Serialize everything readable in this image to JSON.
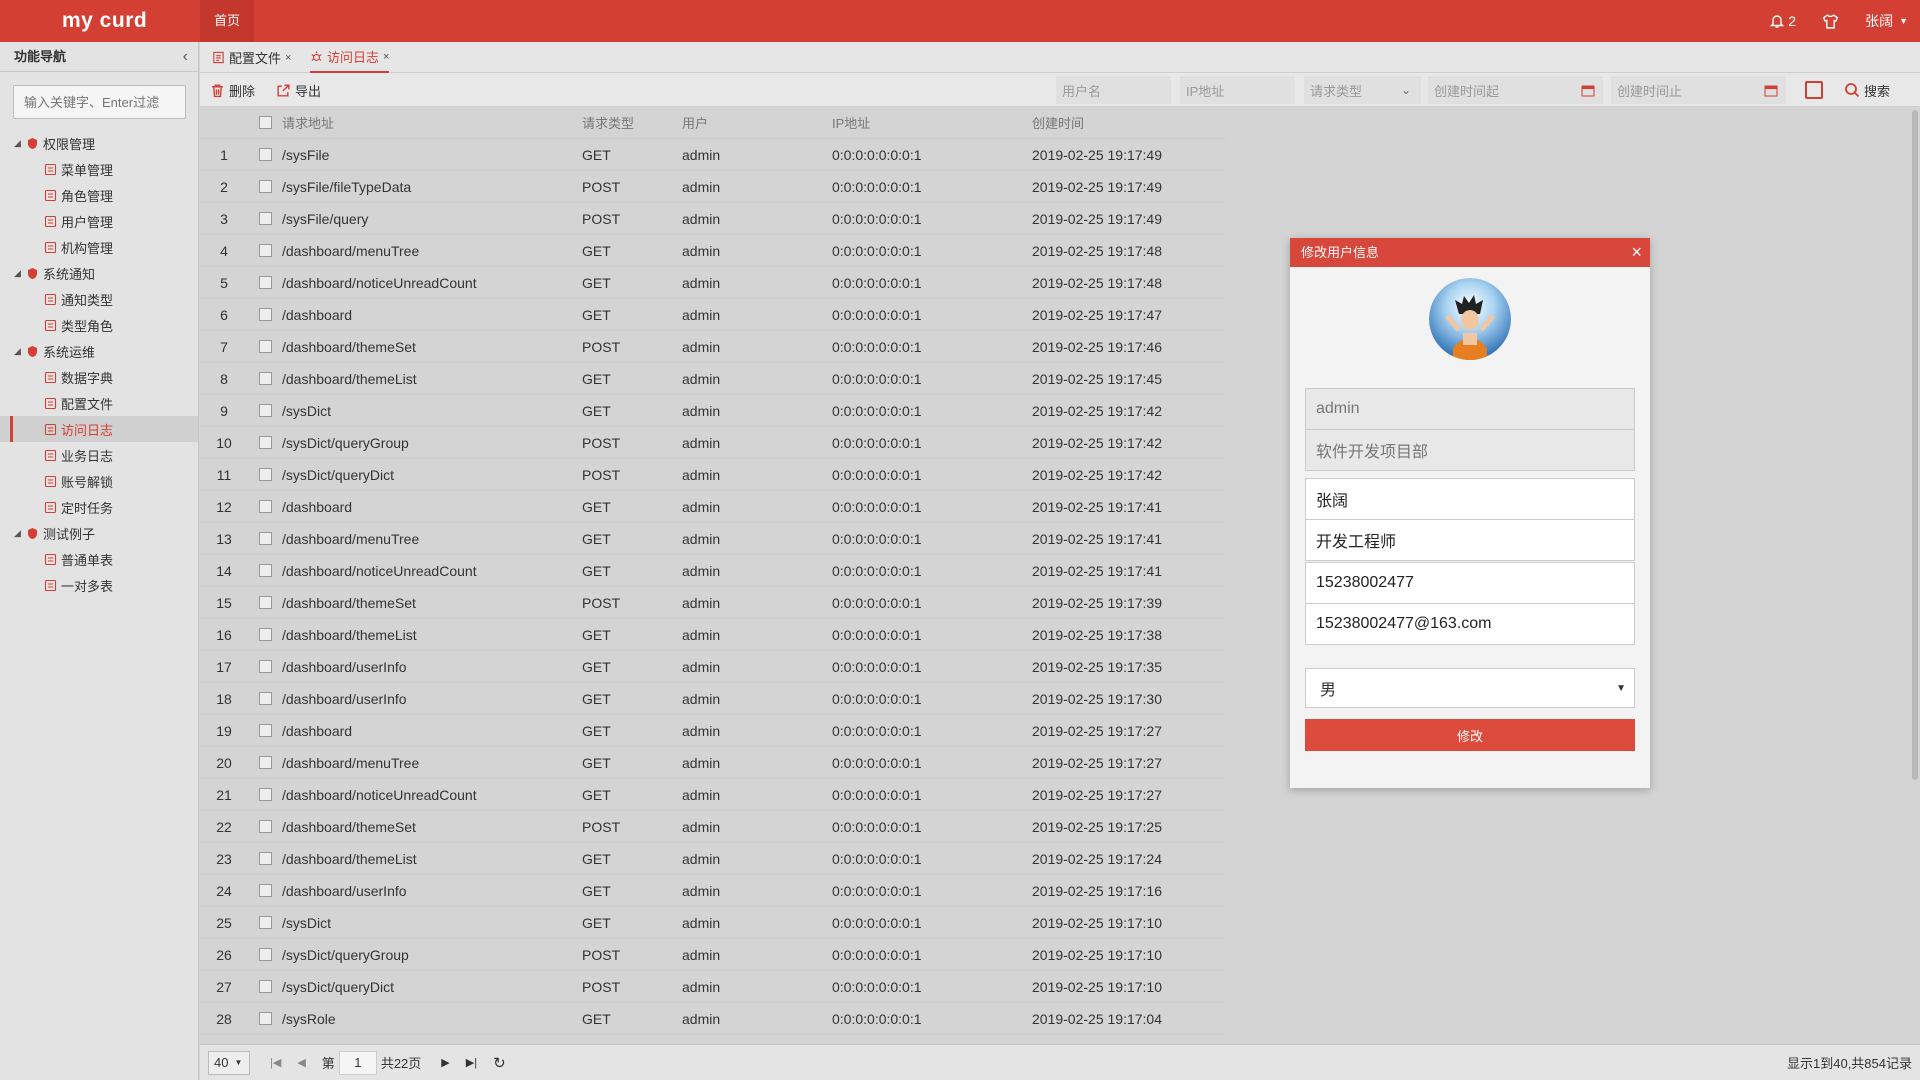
{
  "app": {
    "logo": "my curd",
    "home_tab": "首页",
    "notif_count": "2",
    "user_name": "张阔"
  },
  "sidebar": {
    "title": "功能导航",
    "search_placeholder": "输入关键字、Enter过滤",
    "tree": [
      {
        "type": "group",
        "label": "权限管理",
        "icon": "shield-icon"
      },
      {
        "type": "leaf",
        "label": "菜单管理",
        "icon": "menu-icon"
      },
      {
        "type": "leaf",
        "label": "角色管理",
        "icon": "shirt-icon"
      },
      {
        "type": "leaf",
        "label": "用户管理",
        "icon": "user-icon"
      },
      {
        "type": "leaf",
        "label": "机构管理",
        "icon": "building-icon"
      },
      {
        "type": "group",
        "label": "系统通知",
        "icon": "bell-icon"
      },
      {
        "type": "leaf",
        "label": "通知类型",
        "icon": "grid-icon"
      },
      {
        "type": "leaf",
        "label": "类型角色",
        "icon": "share-icon"
      },
      {
        "type": "group",
        "label": "系统运维",
        "icon": "gears-icon"
      },
      {
        "type": "leaf",
        "label": "数据字典",
        "icon": "book-icon"
      },
      {
        "type": "leaf",
        "label": "配置文件",
        "icon": "file-icon"
      },
      {
        "type": "leaf",
        "label": "访问日志",
        "icon": "bug-icon",
        "active": true
      },
      {
        "type": "leaf",
        "label": "业务日志",
        "icon": "log-icon"
      },
      {
        "type": "leaf",
        "label": "账号解锁",
        "icon": "lock-icon"
      },
      {
        "type": "leaf",
        "label": "定时任务",
        "icon": "clock-icon"
      },
      {
        "type": "group",
        "label": "测试例子",
        "icon": "table-icon"
      },
      {
        "type": "leaf",
        "label": "普通单表",
        "icon": "table-icon"
      },
      {
        "type": "leaf",
        "label": "一对多表",
        "icon": "table-icon"
      }
    ]
  },
  "tabs": [
    {
      "label": "配置文件",
      "close": "×"
    },
    {
      "label": "访问日志",
      "close": "×",
      "active": true
    }
  ],
  "toolbar": {
    "delete_label": "删除",
    "export_label": "导出",
    "username_ph": "用户名",
    "ip_ph": "IP地址",
    "reqtype_ph": "请求类型",
    "time_from_ph": "创建时间起",
    "time_to_ph": "创建时间止",
    "search_label": "搜索"
  },
  "table": {
    "headers": {
      "url": "请求地址",
      "type": "请求类型",
      "user": "用户",
      "ip": "IP地址",
      "time": "创建时间"
    },
    "rows": [
      [
        "1",
        "/sysFile",
        "GET",
        "admin",
        "0:0:0:0:0:0:0:1",
        "2019-02-25 19:17:49"
      ],
      [
        "2",
        "/sysFile/fileTypeData",
        "POST",
        "admin",
        "0:0:0:0:0:0:0:1",
        "2019-02-25 19:17:49"
      ],
      [
        "3",
        "/sysFile/query",
        "POST",
        "admin",
        "0:0:0:0:0:0:0:1",
        "2019-02-25 19:17:49"
      ],
      [
        "4",
        "/dashboard/menuTree",
        "GET",
        "admin",
        "0:0:0:0:0:0:0:1",
        "2019-02-25 19:17:48"
      ],
      [
        "5",
        "/dashboard/noticeUnreadCount",
        "GET",
        "admin",
        "0:0:0:0:0:0:0:1",
        "2019-02-25 19:17:48"
      ],
      [
        "6",
        "/dashboard",
        "GET",
        "admin",
        "0:0:0:0:0:0:0:1",
        "2019-02-25 19:17:47"
      ],
      [
        "7",
        "/dashboard/themeSet",
        "POST",
        "admin",
        "0:0:0:0:0:0:0:1",
        "2019-02-25 19:17:46"
      ],
      [
        "8",
        "/dashboard/themeList",
        "GET",
        "admin",
        "0:0:0:0:0:0:0:1",
        "2019-02-25 19:17:45"
      ],
      [
        "9",
        "/sysDict",
        "GET",
        "admin",
        "0:0:0:0:0:0:0:1",
        "2019-02-25 19:17:42"
      ],
      [
        "10",
        "/sysDict/queryGroup",
        "POST",
        "admin",
        "0:0:0:0:0:0:0:1",
        "2019-02-25 19:17:42"
      ],
      [
        "11",
        "/sysDict/queryDict",
        "POST",
        "admin",
        "0:0:0:0:0:0:0:1",
        "2019-02-25 19:17:42"
      ],
      [
        "12",
        "/dashboard",
        "GET",
        "admin",
        "0:0:0:0:0:0:0:1",
        "2019-02-25 19:17:41"
      ],
      [
        "13",
        "/dashboard/menuTree",
        "GET",
        "admin",
        "0:0:0:0:0:0:0:1",
        "2019-02-25 19:17:41"
      ],
      [
        "14",
        "/dashboard/noticeUnreadCount",
        "GET",
        "admin",
        "0:0:0:0:0:0:0:1",
        "2019-02-25 19:17:41"
      ],
      [
        "15",
        "/dashboard/themeSet",
        "POST",
        "admin",
        "0:0:0:0:0:0:0:1",
        "2019-02-25 19:17:39"
      ],
      [
        "16",
        "/dashboard/themeList",
        "GET",
        "admin",
        "0:0:0:0:0:0:0:1",
        "2019-02-25 19:17:38"
      ],
      [
        "17",
        "/dashboard/userInfo",
        "GET",
        "admin",
        "0:0:0:0:0:0:0:1",
        "2019-02-25 19:17:35"
      ],
      [
        "18",
        "/dashboard/userInfo",
        "GET",
        "admin",
        "0:0:0:0:0:0:0:1",
        "2019-02-25 19:17:30"
      ],
      [
        "19",
        "/dashboard",
        "GET",
        "admin",
        "0:0:0:0:0:0:0:1",
        "2019-02-25 19:17:27"
      ],
      [
        "20",
        "/dashboard/menuTree",
        "GET",
        "admin",
        "0:0:0:0:0:0:0:1",
        "2019-02-25 19:17:27"
      ],
      [
        "21",
        "/dashboard/noticeUnreadCount",
        "GET",
        "admin",
        "0:0:0:0:0:0:0:1",
        "2019-02-25 19:17:27"
      ],
      [
        "22",
        "/dashboard/themeSet",
        "POST",
        "admin",
        "0:0:0:0:0:0:0:1",
        "2019-02-25 19:17:25"
      ],
      [
        "23",
        "/dashboard/themeList",
        "GET",
        "admin",
        "0:0:0:0:0:0:0:1",
        "2019-02-25 19:17:24"
      ],
      [
        "24",
        "/dashboard/userInfo",
        "GET",
        "admin",
        "0:0:0:0:0:0:0:1",
        "2019-02-25 19:17:16"
      ],
      [
        "25",
        "/sysDict",
        "GET",
        "admin",
        "0:0:0:0:0:0:0:1",
        "2019-02-25 19:17:10"
      ],
      [
        "26",
        "/sysDict/queryGroup",
        "POST",
        "admin",
        "0:0:0:0:0:0:0:1",
        "2019-02-25 19:17:10"
      ],
      [
        "27",
        "/sysDict/queryDict",
        "POST",
        "admin",
        "0:0:0:0:0:0:0:1",
        "2019-02-25 19:17:10"
      ],
      [
        "28",
        "/sysRole",
        "GET",
        "admin",
        "0:0:0:0:0:0:0:1",
        "2019-02-25 19:17:04"
      ]
    ]
  },
  "pager": {
    "page_size": "40",
    "page_prefix": "第",
    "page": "1",
    "total_pages": "共22页",
    "summary": "显示1到40,共854记录"
  },
  "modal": {
    "title": "修改用户信息",
    "username": "admin",
    "dept": "软件开发项目部",
    "real_name": "张阔",
    "position": "开发工程师",
    "phone": "15238002477",
    "email": "15238002477@163.com",
    "gender": "男",
    "submit": "修改"
  },
  "colors": {
    "brand": "#d43f33",
    "accent": "#dd4b3c"
  }
}
